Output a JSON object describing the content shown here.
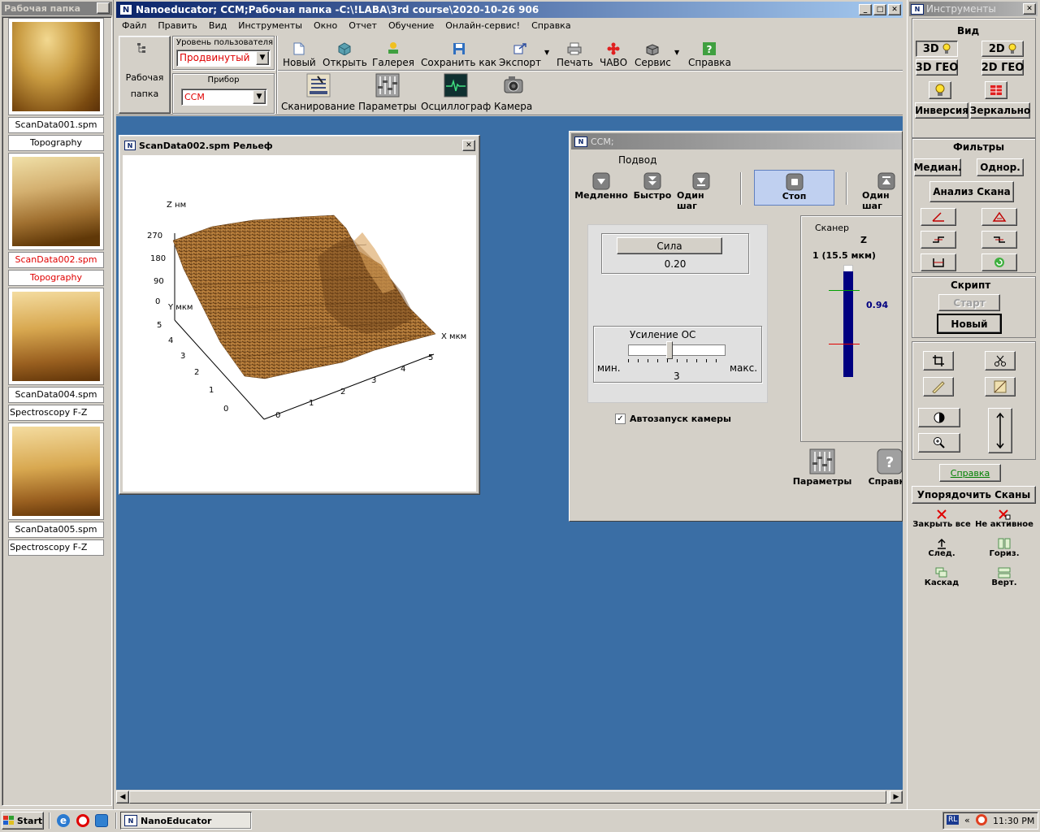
{
  "left_panel": {
    "title": "Рабочая папка",
    "items": [
      {
        "file": "ScanData001.spm",
        "mode": "Topography"
      },
      {
        "file": "ScanData002.spm",
        "mode": "Topography"
      },
      {
        "file": "ScanData004.spm",
        "mode": "Spectroscopy F-Z"
      },
      {
        "file": "ScanData005.spm",
        "mode": "Spectroscopy F-Z"
      }
    ]
  },
  "main_window": {
    "title": "Nanoeducator; CCM;Рабочая папка -C:\\!LABA\\3rd course\\2020-10-26 906",
    "menu": [
      "Файл",
      "Править",
      "Вид",
      "Инструменты",
      "Окно",
      "Отчет",
      "Обучение",
      "Онлайн-сервис!",
      "Справка"
    ]
  },
  "toolbar": {
    "workfolder_label1": "Рабочая",
    "workfolder_label2": "папка",
    "user_level_label": "Уровень пользователя",
    "user_level_value": "Продвинутый",
    "device_label": "Прибор",
    "device_value": "CCM",
    "buttons": [
      "Новый",
      "Открыть",
      "Галерея",
      "Сохранить как",
      "Экспорт",
      "Печать",
      "ЧАВО",
      "Сервис",
      "Справка"
    ],
    "buttons2": [
      "Сканирование",
      "Параметры",
      "Осциллограф",
      "Камера"
    ]
  },
  "scan_window": {
    "title": "ScanData002.spm  Рельеф",
    "z_label": "Z нм",
    "z_ticks": [
      "270",
      "180",
      "90",
      "0"
    ],
    "y_label": "Y мкм",
    "y_ticks": [
      "5",
      "4",
      "3",
      "2",
      "1",
      "0"
    ],
    "x_label": "X мкм",
    "x_ticks": [
      "0",
      "1",
      "2",
      "3",
      "4",
      "5"
    ]
  },
  "ccm_window": {
    "title": "CCM;",
    "approach_label": "Подвод",
    "buttons": [
      "Медленно",
      "Быстро",
      "Один шаг",
      "Стоп",
      "Один шаг"
    ],
    "force_button": "Сила",
    "force_value": "0.20",
    "gain_label": "Усиление ОС",
    "gain_min": "мин.",
    "gain_max": "макс.",
    "gain_value": "3",
    "autostart_label": "Автозапуск камеры",
    "autostart_checked": true,
    "scanner_label": "Сканер",
    "scanner_axis": "Z",
    "scanner_range": "1 (15.5 мкм)",
    "scanner_value": "0.94",
    "bottom_buttons": [
      "Параметры",
      "Справка"
    ]
  },
  "right_panel": {
    "title": "Инструменты",
    "view_label": "Вид",
    "view_buttons": [
      "3D",
      "2D",
      "3D ГЕО",
      "2D ГЕО",
      "Инверсия",
      "Зеркально"
    ],
    "filters_label": "Фильтры",
    "filter_buttons": [
      "Медиан.",
      "Однор.",
      "Анализ Скана"
    ],
    "script_label": "Скрипт",
    "script_start": "Старт",
    "script_new": "Новый",
    "help_button": "Справка",
    "arrange_button": "Упорядочить Сканы",
    "window_actions": [
      "Закрыть все",
      "Не активное",
      "След.",
      "Гориз.",
      "Каскад",
      "Верт."
    ]
  },
  "taskbar": {
    "start": "Start",
    "task": "NanoEducator",
    "lang": "RL",
    "time": "11:30 PM"
  },
  "colors": {
    "workspace": "#3a6ea5",
    "title_active": "#0a246a",
    "title_inactive": "#808080",
    "scanner_bar": "#000080",
    "user_level_text": "#e00000"
  }
}
